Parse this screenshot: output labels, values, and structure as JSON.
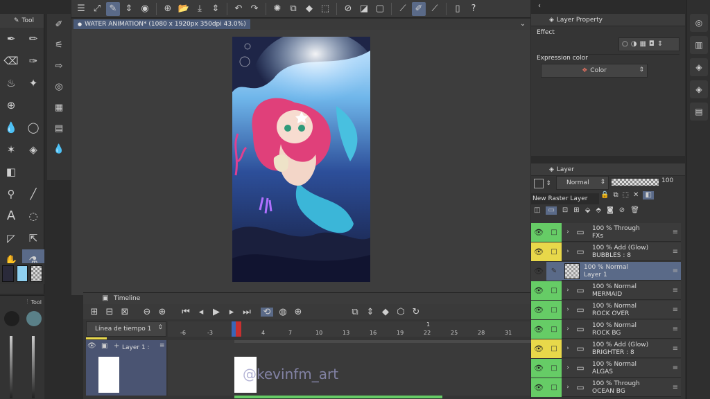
{
  "document": {
    "title": "WATER ANIMATION* (1080 x 1920px 350dpi 43.0%)"
  },
  "tool_panel": {
    "title": "Tool",
    "sub_title": "Tool"
  },
  "property_panel": {
    "title": "Layer Property",
    "effect_label": "Effect",
    "expression_color_label": "Expression color",
    "expression_color_value": "Color"
  },
  "layer_panel": {
    "title": "Layer",
    "blend_mode": "Normal",
    "opacity": "100",
    "tooltip": "New Raster Layer",
    "layers": [
      {
        "line1": "100 % Through",
        "line2": "FXs",
        "type": "folder",
        "eye_color": "#66cc66"
      },
      {
        "line1": "100 % Add (Glow)",
        "line2": "BUBBLES : 8",
        "type": "folder",
        "eye_color": "#e8d84a"
      },
      {
        "line1": "100 % Normal",
        "line2": "Layer 1",
        "type": "raster",
        "eye_color": "#3b3b3b",
        "selected": true
      },
      {
        "line1": "100 % Normal",
        "line2": "MERMAID",
        "type": "folder",
        "eye_color": "#66cc66"
      },
      {
        "line1": "100 % Normal",
        "line2": "ROCK OVER",
        "type": "folder",
        "eye_color": "#66cc66"
      },
      {
        "line1": "100 % Normal",
        "line2": "ROCK BG",
        "type": "folder",
        "eye_color": "#66cc66"
      },
      {
        "line1": "100 % Add (Glow)",
        "line2": "BRIGHTER : 8",
        "type": "folder",
        "eye_color": "#e8d84a"
      },
      {
        "line1": "100 % Normal",
        "line2": "ALGAS",
        "type": "folder",
        "eye_color": "#66cc66"
      },
      {
        "line1": "100 % Through",
        "line2": "OCEAN BG",
        "type": "folder",
        "eye_color": "#66cc66"
      }
    ]
  },
  "timeline": {
    "title": "Timeline",
    "track_name": "Línea de tiempo 1",
    "layer_label": "Layer 1 :",
    "frame_labels": [
      "-6",
      "-3",
      "1",
      "4",
      "7",
      "10",
      "13",
      "16",
      "19",
      "22",
      "25",
      "28",
      "31"
    ],
    "marker_top": "1"
  },
  "watermark": "@kevinfm_art",
  "colors": {
    "accent": "#5a6a88",
    "main_color": "#8fd0f0",
    "sub_color": "#2a2a3a"
  }
}
